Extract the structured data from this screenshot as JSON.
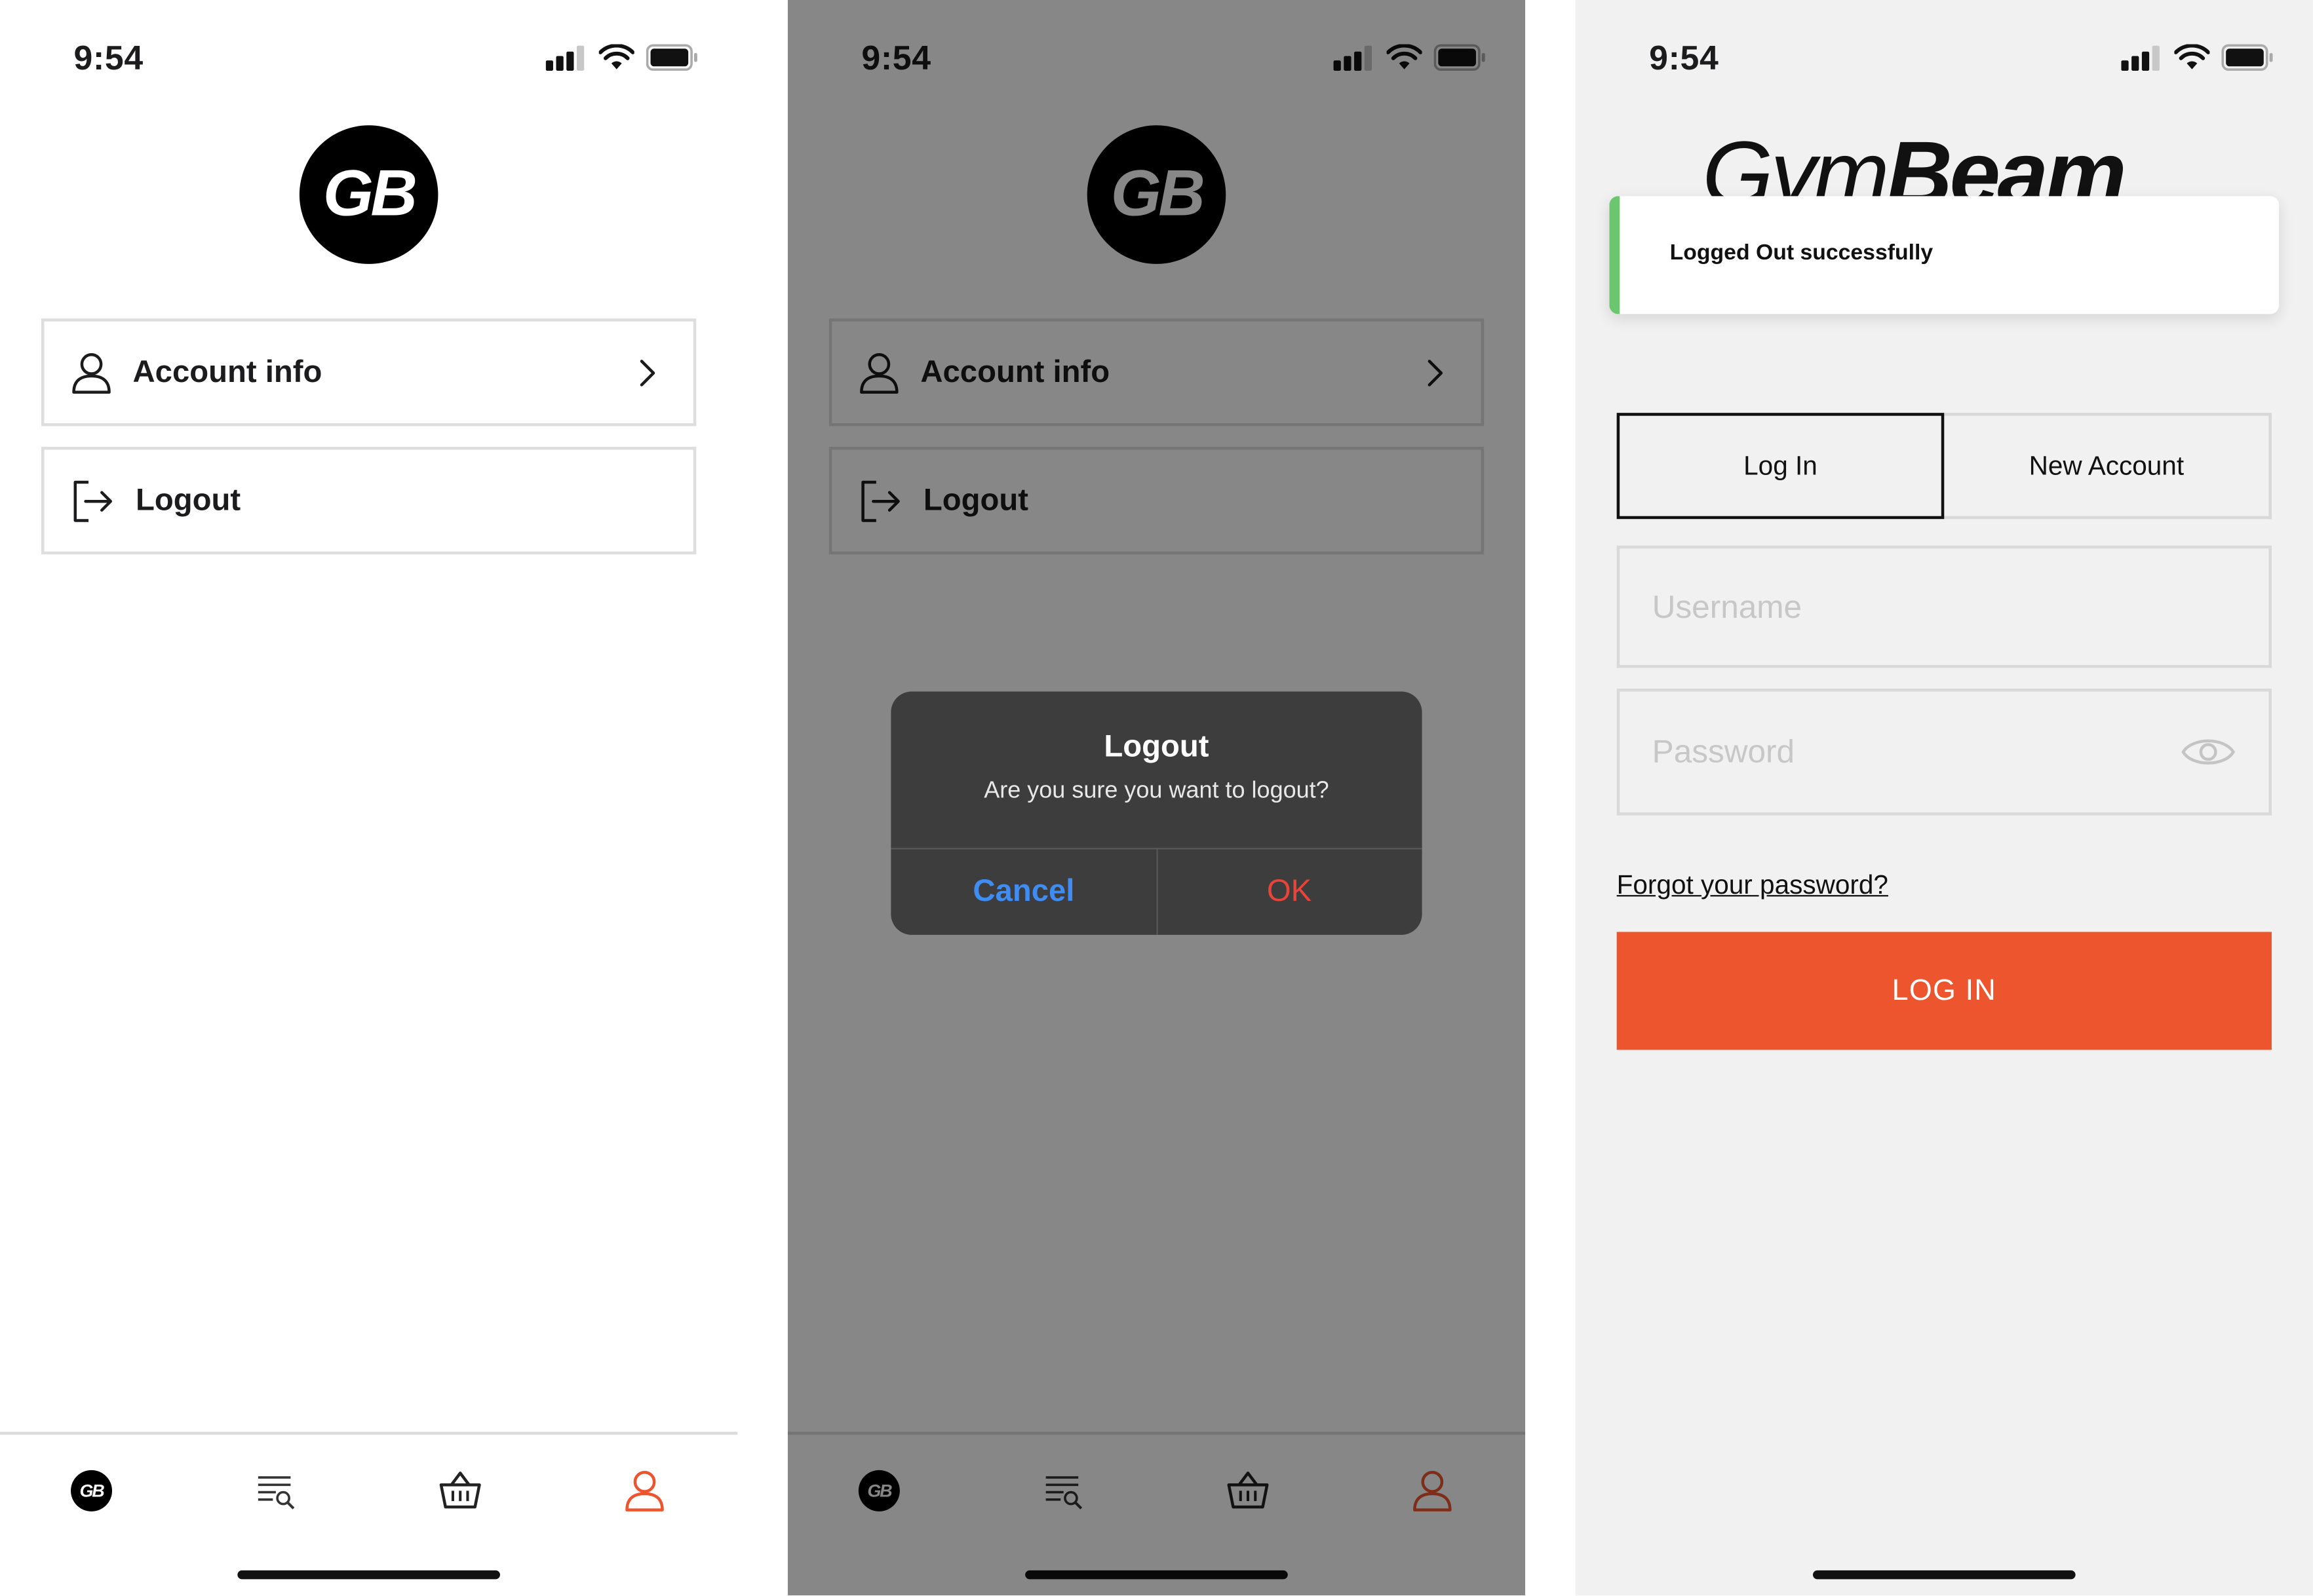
{
  "status_bar": {
    "time": "9:54"
  },
  "account": {
    "logo_text": "GB",
    "menu": {
      "account_info": "Account info",
      "logout": "Logout"
    }
  },
  "tabbar": {
    "home_badge": "GB",
    "active_tab": "profile",
    "active_color": "#ed552f"
  },
  "dialog": {
    "title": "Logout",
    "message": "Are you sure you want to logout?",
    "cancel_label": "Cancel",
    "ok_label": "OK",
    "cancel_color": "#3f8cf3",
    "ok_color": "#e8443a"
  },
  "login": {
    "brand_regular": "Gym",
    "brand_bold": "Beam",
    "toast": "Logged Out successfully",
    "toast_accent": "#6cc56f",
    "tab_login": "Log In",
    "tab_new_account": "New Account",
    "username_placeholder": "Username",
    "password_placeholder": "Password",
    "forgot_link": "Forgot your password?",
    "submit_label": "LOG IN",
    "submit_color": "#ed552f"
  }
}
